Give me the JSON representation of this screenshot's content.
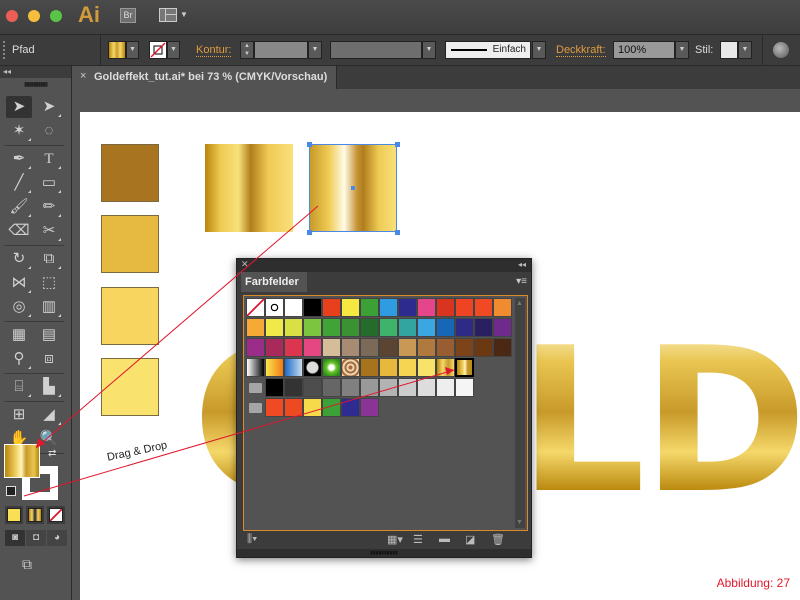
{
  "app": {
    "logo": "Ai",
    "bridge_label": "Br"
  },
  "control_bar": {
    "object_type": "Pfad",
    "kontur_label": "Kontur:",
    "kontur_value": "",
    "stroke_style": "Einfach",
    "deckkraft_label": "Deckkraft:",
    "deckkraft_value": "100%",
    "stil_label": "Stil:"
  },
  "document_tab": {
    "close": "×",
    "title": "Goldeffekt_tut.ai* bei 73 % (CMYK/Vorschau)"
  },
  "swatches_panel": {
    "tab_label": "Farbfelder",
    "rows": [
      [
        "none",
        "registration",
        "#ffffff",
        "#000000",
        "#e8401c",
        "#f6e840",
        "#3ba136",
        "#2f9be0",
        "#2e2b8e",
        "#e5458a",
        "#d9341f",
        "#ee4423",
        "#ef4a24",
        "#f08b2f"
      ],
      [
        "#f6a934",
        "#f1e84a",
        "#d8e044",
        "#7cc53f",
        "#3fa338",
        "#3b9233",
        "#256b2c",
        "#3fb36a",
        "#33a5a0",
        "#3aa6e2",
        "#1667b7",
        "#2e2b86",
        "#2a1f61",
        "#702a8c"
      ],
      [
        "#9a2c8a",
        "#a8295a",
        "#dc3550",
        "#e44781",
        "#d5bd9a",
        "#a88b74",
        "#7b6a58",
        "#5c4433",
        "#c99855",
        "#b07a3e",
        "#985d30",
        "#7e4419",
        "#6b3812",
        "#4a2813"
      ],
      [
        "grad-gray",
        "grad-yellow-orange",
        "grad-blue-check",
        "grad-radial-check",
        "pattern-green",
        "pattern-brown",
        "#a8731d",
        "#e6b93c",
        "#f6d552",
        "#f7e36a",
        "grad-gold-1",
        "grad-gold-2"
      ],
      [
        "folder",
        "#000000",
        "#333333",
        "#4d4d4d",
        "#666666",
        "#808080",
        "#999999",
        "#b3b3b3",
        "#cccccc",
        "#dddddd",
        "#eeeeee",
        "#f5f5f5"
      ],
      [
        "folder",
        "#ef4a24",
        "#ee4a22",
        "#f7da4a",
        "#3ca137",
        "#2e2c91",
        "#8a3496"
      ]
    ]
  },
  "canvas": {
    "gold_text": "GOLD",
    "drag_label": "Drag & Drop",
    "caption": "Abbildung: 27",
    "solid_squares": [
      "#a87420",
      "#e6b941",
      "#f7d55e",
      "#f9e26e"
    ]
  }
}
